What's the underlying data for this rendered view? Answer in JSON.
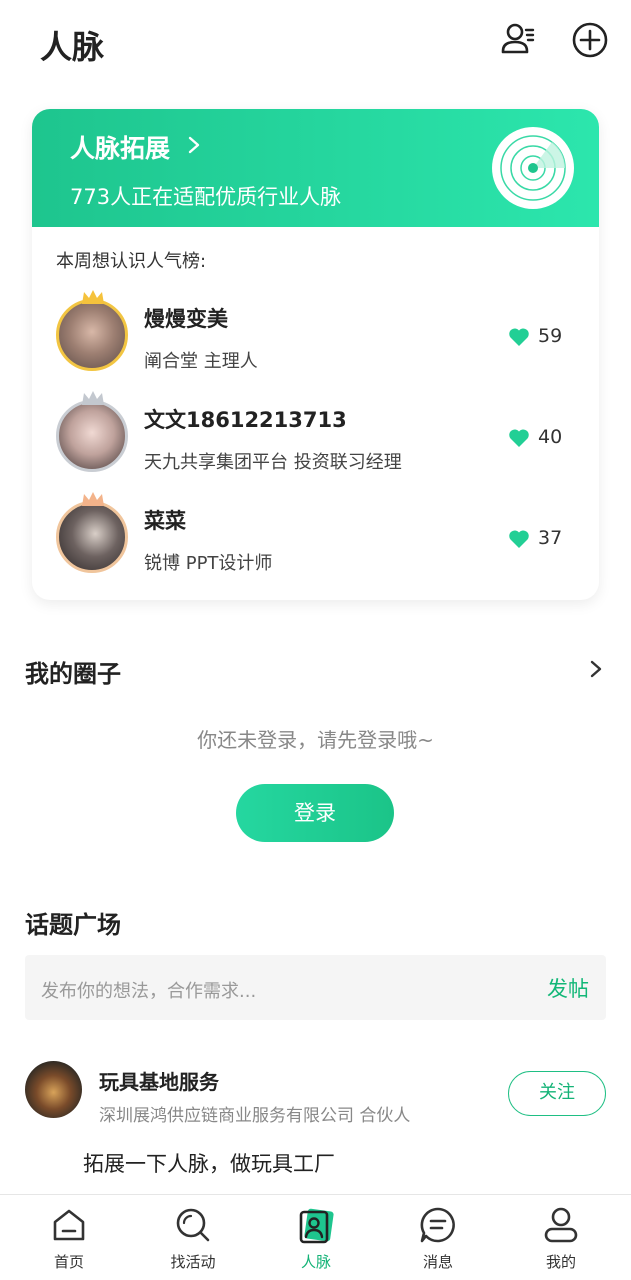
{
  "header": {
    "title": "人脉"
  },
  "banner": {
    "title": "人脉拓展",
    "subtitle": "773人正在适配优质行业人脉"
  },
  "ranking": {
    "title": "本周想认识人气榜:",
    "items": [
      {
        "name": "熳熳变美",
        "desc": "阐合堂  主理人",
        "likes": "59",
        "crown": "gold"
      },
      {
        "name": "文文18612213713",
        "desc": "天九共享集团平台  投资联习经理",
        "likes": "40",
        "crown": "silver"
      },
      {
        "name": "菜菜",
        "desc": "锐博  PPT设计师",
        "likes": "37",
        "crown": "bronze"
      }
    ]
  },
  "circle": {
    "title": "我的圈子",
    "hint": "你还未登录，请先登录哦~",
    "login_label": "登录"
  },
  "topics": {
    "title": "话题广场",
    "placeholder": "发布你的想法，合作需求...",
    "post_label": "发帖",
    "items": [
      {
        "name": "玩具基地服务",
        "company": "深圳展鸿供应链商业服务有限公司 合伙人",
        "follow_label": "关注",
        "content": "拓展一下人脉，做玩具工厂"
      }
    ]
  },
  "tabbar": {
    "items": [
      {
        "label": "首页",
        "icon": "home-icon"
      },
      {
        "label": "找活动",
        "icon": "search-icon"
      },
      {
        "label": "人脉",
        "icon": "contacts-card-icon",
        "active": true
      },
      {
        "label": "消息",
        "icon": "message-icon"
      },
      {
        "label": "我的",
        "icon": "profile-icon"
      }
    ]
  },
  "colors": {
    "brand_green": "#1ec58e",
    "accent_text_green": "#14b377",
    "heart": "#22cf95"
  }
}
